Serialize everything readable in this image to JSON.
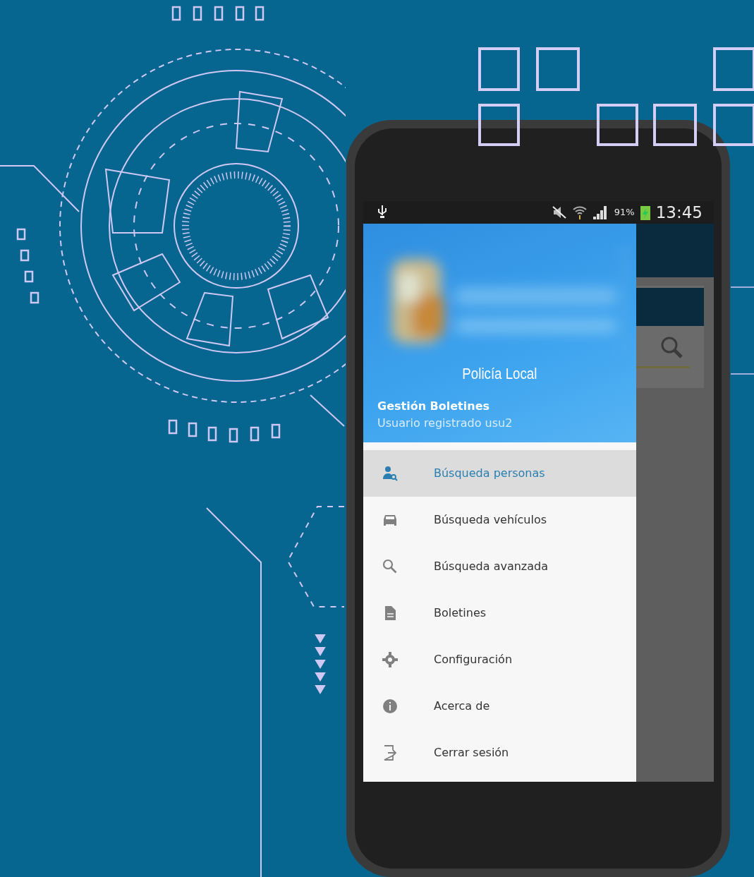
{
  "status_bar": {
    "battery": "91%",
    "time": "13:45"
  },
  "drawer": {
    "header": {
      "kind": "picture",
      "title": "Policía Local",
      "app_name": "Gestión Boletines",
      "user": "Usuario registrado usu2"
    },
    "items": [
      {
        "label": "Búsqueda personas",
        "selected": true
      },
      {
        "label": "Búsqueda vehículos",
        "selected": false
      },
      {
        "label": "Búsqueda avanzada",
        "selected": false
      },
      {
        "label": "Boletines",
        "selected": false
      },
      {
        "label": "Configuración",
        "selected": false
      },
      {
        "label": "Acerca de",
        "selected": false
      },
      {
        "label": "Cerrar sesión",
        "selected": false
      }
    ]
  }
}
